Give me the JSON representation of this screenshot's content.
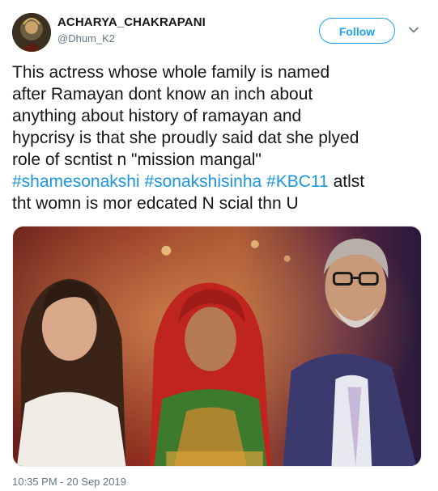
{
  "user": {
    "display_name": "ACHARYA_CHAKRAPANI",
    "handle": "@Dhum_K2",
    "avatar_icon": "profile-avatar"
  },
  "actions": {
    "follow_label": "Follow",
    "more_icon": "chevron-down-icon"
  },
  "tweet": {
    "lines": [
      "This actress whose whole family is named",
      "after Ramayan dont know an inch about",
      "anything about history of ramayan and",
      "hypcrisy is that she proudly said dat she plyed",
      "role of scntist n \"mission mangal\""
    ],
    "hashtags": [
      "#shamesonakshi",
      "#sonakshisinha",
      "#KBC11"
    ],
    "tail_same_line": "atlst",
    "last_line": "tht womn is mor edcated N scial thn U"
  },
  "media": {
    "description_icon": "photo-image"
  },
  "timestamp": "10:35 PM - 20 Sep 2019",
  "colors": {
    "accent": "#1da1f2",
    "hashtag": "#1b95e0",
    "secondary_text": "#657786",
    "primary_text": "#14171a"
  }
}
